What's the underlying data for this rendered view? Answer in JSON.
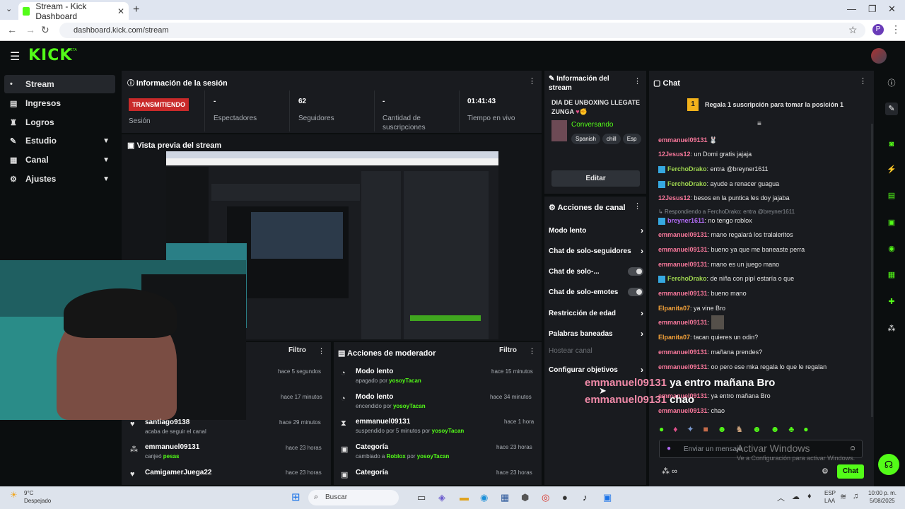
{
  "browser": {
    "tab_title": "Stream - Kick Dashboard",
    "url": "dashboard.kick.com/stream",
    "profile_initial": "P"
  },
  "kick": {
    "logo": "KICK",
    "beta": "BETA"
  },
  "nav": [
    {
      "label": "Stream",
      "icon": "•"
    },
    {
      "label": "Ingresos",
      "icon": "▤"
    },
    {
      "label": "Logros",
      "icon": "♜"
    },
    {
      "label": "Estudio",
      "icon": "✎"
    },
    {
      "label": "Canal",
      "icon": "▦"
    },
    {
      "label": "Ajustes",
      "icon": "⚙"
    }
  ],
  "session": {
    "title": "Información de la sesión",
    "status": "TRANSMITIENDO",
    "session_label": "Sesión",
    "viewers_value": "-",
    "viewers_label": "Espectadores",
    "followers_value": "62",
    "followers_label": "Seguidores",
    "subs_value": "-",
    "subs_label": "Cantidad de suscripciones",
    "live_value": "01:41:43",
    "live_label": "Tiempo en vivo"
  },
  "preview": {
    "title": "Vista previa del stream"
  },
  "activity": {
    "filter": "Filtro",
    "items": [
      {
        "time": "hace 5 segundos"
      },
      {
        "time": "hace 17 minutos"
      },
      {
        "name": "santiago9138",
        "sub": "acaba de seguir el canal",
        "time": "hace 29 minutos"
      },
      {
        "name": "emmanuel09131",
        "sub_pre": "canjeó ",
        "sub_hl": "pesas",
        "time": "hace 23 horas"
      },
      {
        "name": "CamigamerJuega22",
        "time": "hace 23 horas"
      }
    ]
  },
  "mod": {
    "title": "Acciones de moderador",
    "filter": "Filtro",
    "items": [
      {
        "name": "Modo lento",
        "sub_pre": "apagado por ",
        "sub_hl": "yosoyTacan",
        "time": "hace 15 minutos"
      },
      {
        "name": "Modo lento",
        "sub_pre": "encendido por ",
        "sub_hl": "yosoyTacan",
        "time": "hace 34 minutos"
      },
      {
        "name": "emmanuel09131",
        "sub_pre": "suspendido por 5 minutos por ",
        "sub_hl": "yosoyTacan",
        "time": "hace 1 hora"
      },
      {
        "name": "Categoría",
        "sub_pre": "cambiado a ",
        "sub_hl": "Roblox",
        "sub_post": " por ",
        "sub_hl2": "yosoyTacan",
        "time": "hace 23 horas"
      },
      {
        "name": "Categoría",
        "time": "hace 23 horas"
      }
    ]
  },
  "stream_info": {
    "title": "Información del stream",
    "stream_title": "DIA DE UNBOXING LLEGATE ZUNGA",
    "category": "Conversando",
    "tags": [
      "Spanish",
      "chill",
      "Esp"
    ],
    "edit": "Editar"
  },
  "channel_actions": {
    "title": "Acciones de canal",
    "items": [
      "Modo lento",
      "Chat de solo-seguidores",
      "Chat de solo-...",
      "Chat de solo-emotes",
      "Restricción de edad",
      "Palabras baneadas",
      "Hostear canal",
      "Configurar objetivos"
    ]
  },
  "chat": {
    "title": "Chat",
    "goal_rank": "1",
    "goal_text": "Regala 1 suscripción para tomar la posición 1",
    "lines": [
      {
        "user": "emmanuel09131",
        "cls": "u1",
        "msg": " "
      },
      {
        "user": "12Jesus12",
        "cls": "u1",
        "msg": ": un Domi gratis jajaja"
      },
      {
        "user": "FerchoDrako",
        "cls": "u2",
        "msg": ": entra @breyner1611",
        "badge": true
      },
      {
        "user": "FerchoDrako",
        "cls": "u2",
        "msg": ": ayude a renacer guagua",
        "badge": true
      },
      {
        "user": "12Jesus12",
        "cls": "u1",
        "msg": ": besos en la puntica les doy jajaba"
      },
      {
        "user": "breyner1611",
        "cls": "u4",
        "msg": ": no tengo roblox",
        "badge": true,
        "reply": "Respondiendo a FerchoDrako: entra @breyner1611"
      },
      {
        "user": "emmanuel09131",
        "cls": "u1",
        "msg": ": mano regalará los tralaleritos"
      },
      {
        "user": "emmanuel09131",
        "cls": "u1",
        "msg": ": bueno ya que me baneaste perra"
      },
      {
        "user": "emmanuel09131",
        "cls": "u1",
        "msg": ": mano es un juego mano"
      },
      {
        "user": "FerchoDrako",
        "cls": "u2",
        "msg": ": de niña con pipí estaría o que",
        "badge": true
      },
      {
        "user": "emmanuel09131",
        "cls": "u1",
        "msg": ": bueno mano"
      },
      {
        "user": "Elpanita07",
        "cls": "u3",
        "msg": ": ya vine Bro"
      },
      {
        "user": "emmanuel09131",
        "cls": "u1",
        "msg": ": "
      },
      {
        "user": "Elpanita07",
        "cls": "u3",
        "msg": ": tacan quieres un odin?"
      },
      {
        "user": "emmanuel09131",
        "cls": "u1",
        "msg": ": mañana prendes?"
      },
      {
        "user": "emmanuel09131",
        "cls": "u1",
        "msg": ": oo pero ese mka regala lo que le regalan"
      },
      {
        "user": "emmanuel09131",
        "cls": "u1",
        "msg": ": ya entro mañana Bro"
      },
      {
        "user": "emmanuel09131",
        "cls": "u1",
        "msg": ": chao"
      }
    ],
    "input_placeholder": "Enviar un mensaje",
    "send": "Chat"
  },
  "overlay": {
    "user": "emmanuel09131",
    "msg1": "ya entro mañana Bro",
    "msg2": "chao",
    "activate_title": "Activar Windows",
    "activate_sub": "Ve a Configuración para activar Windows."
  },
  "taskbar": {
    "weather_temp": "9°C",
    "weather_desc": "Despejado",
    "search": "Buscar",
    "lang1": "ESP",
    "lang2": "LAA",
    "time": "10:00 p. m.",
    "date": "5/08/2025"
  }
}
